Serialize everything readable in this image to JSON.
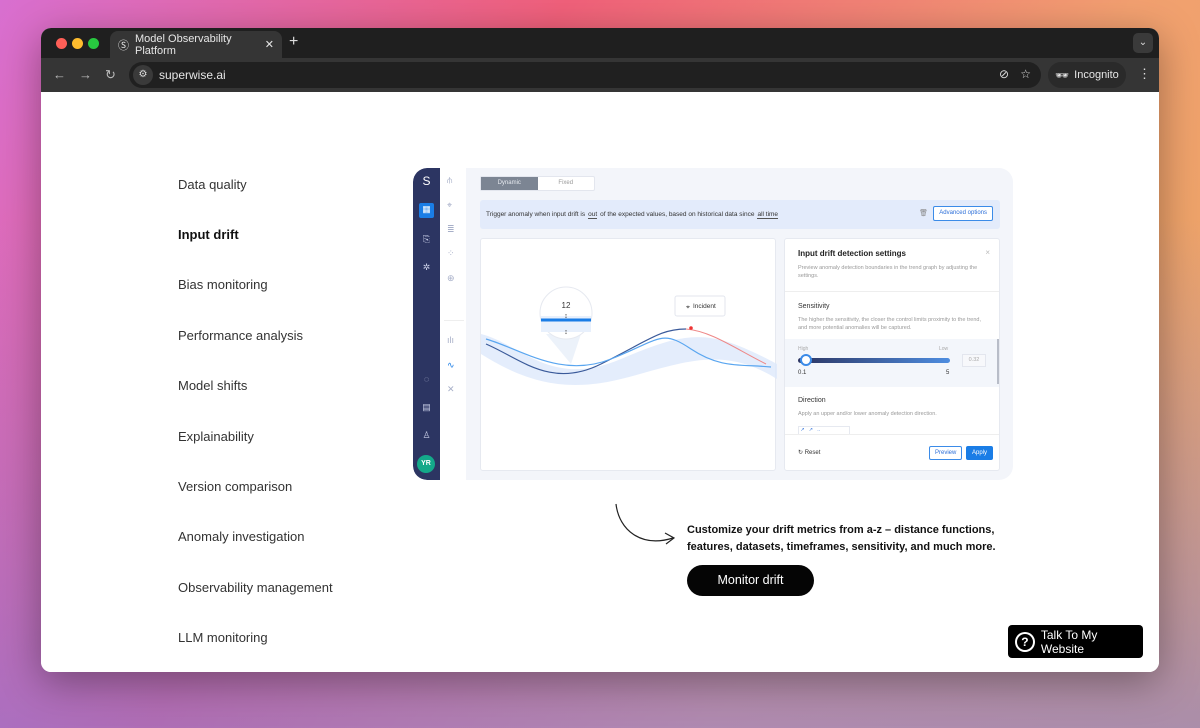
{
  "browser": {
    "tab_title": "Model Observability Platform",
    "url": "superwise.ai",
    "profile": "Incognito"
  },
  "menu": [
    {
      "label": "Data quality",
      "active": false
    },
    {
      "label": "Input drift",
      "active": true
    },
    {
      "label": "Bias monitoring",
      "active": false
    },
    {
      "label": "Performance analysis",
      "active": false
    },
    {
      "label": "Model shifts",
      "active": false
    },
    {
      "label": "Explainability",
      "active": false
    },
    {
      "label": "Version comparison",
      "active": false
    },
    {
      "label": "Anomaly investigation",
      "active": false
    },
    {
      "label": "Observability management",
      "active": false
    },
    {
      "label": "LLM monitoring",
      "active": false
    }
  ],
  "app": {
    "avatar": "YR",
    "toggle": {
      "dynamic": "Dynamic",
      "fixed": "Fixed",
      "selected": "Dynamic"
    },
    "banner": {
      "pre": "Trigger anomaly when input drift is",
      "out": "out",
      "mid": "of the expected values, based on historical data since",
      "since": "all time",
      "advanced": "Advanced options"
    },
    "chart": {
      "bubble_value": "12",
      "incident": "Incident"
    },
    "settings": {
      "title": "Input drift detection settings",
      "desc": "Preview anomaly detection boundaries in the trend graph by adjusting the settings.",
      "sensitivity_title": "Sensitivity",
      "sensitivity_desc": "The higher the sensitivity, the closer the control limits proximity to the trend, and more potential anomalies will be captured.",
      "high": "High",
      "low": "Low",
      "min": "0.1",
      "max": "5",
      "value": "0.32",
      "slider_fraction": 0.05,
      "direction_title": "Direction",
      "direction_desc": "Apply an upper and/or lower anomaly detection direction.",
      "reset": "Reset",
      "preview": "Preview",
      "apply": "Apply"
    }
  },
  "cta": {
    "text": "Customize your drift metrics from a-z – distance functions, features, datasets, timeframes, sensitivity, and much more.",
    "button": "Monitor drift"
  },
  "chat_widget": {
    "label": "Talk To My Website"
  },
  "colors": {
    "sidebar": "#2c3562",
    "accent": "#1a7de6",
    "button": "#050505"
  }
}
